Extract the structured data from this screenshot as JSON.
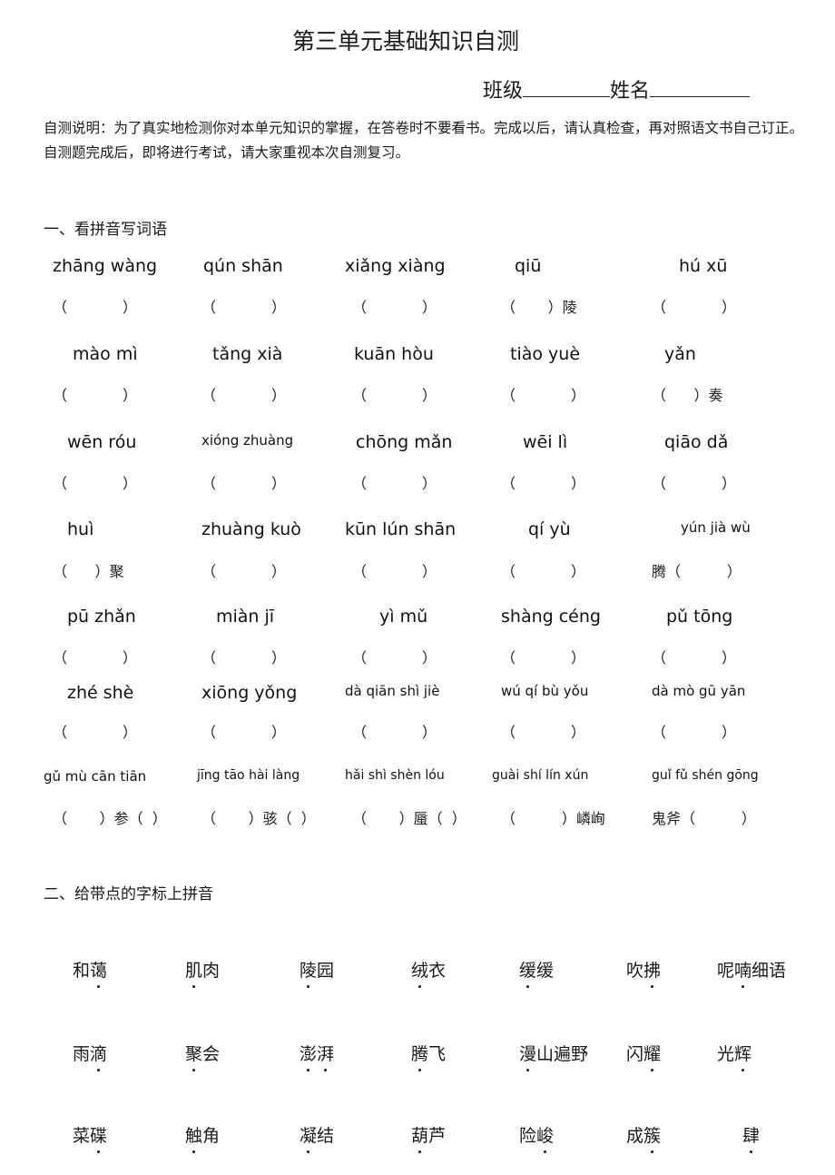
{
  "title": "第三单元基础知识自测",
  "header_fields": {
    "class_label": "班级",
    "name_label": "姓名"
  },
  "intro": "自测说明：为了真实地检测你对本单元知识的掌握，在答卷时不要看书。完成以后，请认真检查，再对照语文书自己订正。自测题完成后，即将进行考试，请大家重视本次自测复习。",
  "section1": {
    "heading": "一、看拼音写词语",
    "rows": [
      [
        {
          "pinyin": "zhāng wàng",
          "answer": "(            )"
        },
        {
          "pinyin": "qún shān",
          "answer": "(            )"
        },
        {
          "pinyin": "xiǎng xiàng",
          "answer": "(            )"
        },
        {
          "pinyin": "qiū",
          "answer": "(       )陵"
        },
        {
          "pinyin": "hú xū",
          "answer": "(            )"
        }
      ],
      [
        {
          "pinyin": "mào mì",
          "answer": "(            )"
        },
        {
          "pinyin": "tǎng xià",
          "answer": "(            )"
        },
        {
          "pinyin": "kuān hòu",
          "answer": "(            )"
        },
        {
          "pinyin": "tiào yuè",
          "answer": "(            )"
        },
        {
          "pinyin": "yǎn",
          "answer": "(      )奏"
        }
      ],
      [
        {
          "pinyin": "wēn róu",
          "answer": "(            )"
        },
        {
          "pinyin": "xióng zhuàng",
          "answer": "(            )"
        },
        {
          "pinyin": "chōng mǎn",
          "answer": "(            )"
        },
        {
          "pinyin": "wēi lì",
          "answer": "(            )"
        },
        {
          "pinyin": "qiāo dǎ",
          "answer": "(            )"
        }
      ],
      [
        {
          "pinyin": "huì",
          "answer": "(      )聚"
        },
        {
          "pinyin": "zhuàng kuò",
          "answer": "(            )"
        },
        {
          "pinyin": "kūn lún shān",
          "answer": "(            )"
        },
        {
          "pinyin": "qí yù",
          "answer": "(            )"
        },
        {
          "pinyin": "yún jià wù",
          "answer": "腾(          )"
        }
      ],
      [
        {
          "pinyin": "pū zhǎn",
          "answer": "(            )"
        },
        {
          "pinyin": "miàn jī",
          "answer": "(            )"
        },
        {
          "pinyin": "yì mǔ",
          "answer": "(            )"
        },
        {
          "pinyin": "shàng céng",
          "answer": "(            )"
        },
        {
          "pinyin": "pǔ tōng",
          "answer": "(            )"
        }
      ],
      [
        {
          "pinyin": "zhé shè",
          "answer": "(            )"
        },
        {
          "pinyin": "xiōng yǒng",
          "answer": "(            )"
        },
        {
          "pinyin": "dà qiān shì jiè",
          "answer": "(            )"
        },
        {
          "pinyin": "wú qí bù yǒu",
          "answer": "(            )"
        },
        {
          "pinyin": "dà mò gū yān",
          "answer": "(            )"
        }
      ],
      [
        {
          "pinyin": "gǔ mù cān tiān",
          "answer": "(       )参(  )"
        },
        {
          "pinyin": "jīng tāo hài làng",
          "answer": "(       )骇(  )"
        },
        {
          "pinyin": "hǎi shì shèn lóu",
          "answer": "(       )蜃(  )"
        },
        {
          "pinyin": "guài shí lín xún",
          "answer": "(          )嶙峋"
        },
        {
          "pinyin": "guǐ fǔ shén gōng",
          "answer": "鬼斧(          )"
        }
      ]
    ]
  },
  "section2": {
    "heading": "二、给带点的字标上拼音",
    "rows": [
      [
        {
          "word": "和蔼",
          "dots": [
            1
          ]
        },
        {
          "word": "肌肉",
          "dots": [
            0
          ]
        },
        {
          "word": "陵园",
          "dots": [
            0
          ]
        },
        {
          "word": "绒衣",
          "dots": [
            0
          ]
        },
        {
          "word": "缓缓",
          "dots": [
            0
          ]
        },
        {
          "word": "吹拂",
          "dots": [
            1
          ]
        },
        {
          "word": "呢喃细语",
          "dots": [
            1
          ]
        }
      ],
      [
        {
          "word": "雨滴",
          "dots": [
            1
          ]
        },
        {
          "word": "聚会",
          "dots": [
            0
          ]
        },
        {
          "word": "澎湃",
          "dots": [
            0,
            1
          ]
        },
        {
          "word": "腾飞",
          "dots": [
            0
          ]
        },
        {
          "word": "漫山遍野",
          "dots": [
            0
          ]
        },
        {
          "word": "闪耀",
          "dots": [
            1
          ]
        },
        {
          "word": "光辉",
          "dots": [
            1
          ]
        }
      ],
      [
        {
          "word": "菜碟",
          "dots": [
            1
          ]
        },
        {
          "word": "触角",
          "dots": [
            0
          ]
        },
        {
          "word": "凝结",
          "dots": [
            0
          ]
        },
        {
          "word": "葫芦",
          "dots": [
            0
          ]
        },
        {
          "word": "险峻",
          "dots": [
            1
          ]
        },
        {
          "word": "成簇",
          "dots": [
            1
          ]
        },
        {
          "word": "肆",
          "dots": [
            0
          ]
        }
      ]
    ]
  }
}
